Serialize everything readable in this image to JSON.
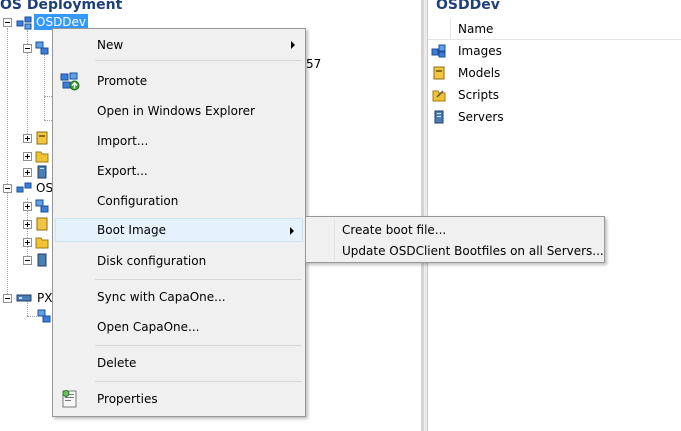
{
  "left_pane": {
    "title": "OS Deployment",
    "tree": {
      "selected_node": "OSDDev",
      "node_os_prefix": "OS",
      "node_px_prefix": "PX",
      "partial_text": "57"
    }
  },
  "right_pane": {
    "title": "OSDDev",
    "column_header": "Name",
    "items": [
      {
        "label": "Images",
        "icon": "images-icon"
      },
      {
        "label": "Models",
        "icon": "models-icon"
      },
      {
        "label": "Scripts",
        "icon": "scripts-icon"
      },
      {
        "label": "Servers",
        "icon": "servers-icon"
      }
    ]
  },
  "context_menu": {
    "items": [
      {
        "label": "New",
        "submenu": true
      },
      {
        "label": "Promote",
        "icon": "promote-icon"
      },
      {
        "label": "Open in Windows Explorer"
      },
      {
        "label": "Import..."
      },
      {
        "label": "Export..."
      },
      {
        "label": "Configuration"
      },
      {
        "label": "Boot Image",
        "submenu": true,
        "highlighted": true
      },
      {
        "label": "Disk configuration"
      },
      {
        "label": "Sync with CapaOne..."
      },
      {
        "label": "Open CapaOne..."
      },
      {
        "label": "Delete"
      },
      {
        "label": "Properties",
        "icon": "properties-icon"
      }
    ]
  },
  "boot_image_submenu": {
    "items": [
      {
        "label": "Create boot file..."
      },
      {
        "label": "Update OSDClient Bootfiles on all Servers..."
      }
    ]
  },
  "colors": {
    "title": "#1e3f7a",
    "selection": "#3399ff",
    "menu_bg": "#f0f0f0",
    "menu_hover": "#e5f1fb"
  }
}
